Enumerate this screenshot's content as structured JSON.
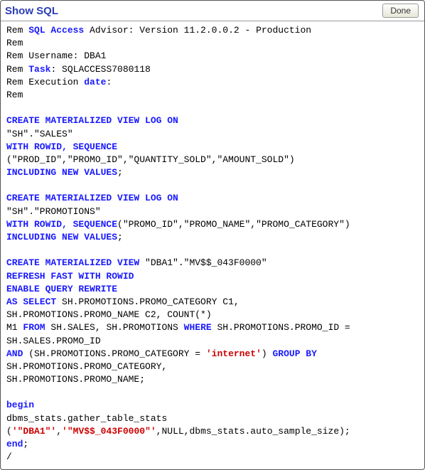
{
  "header": {
    "title": "Show SQL",
    "done_label": "Done"
  },
  "rem": {
    "l1_a": "Rem ",
    "l1_b": "SQL Access",
    "l1_c": " Advisor: Version 11.2.0.0.2 - Production",
    "l2": "Rem",
    "l3": "Rem Username: DBA1",
    "l4_a": "Rem ",
    "l4_b": "Task",
    "l4_c": ": SQLACCESS7080118",
    "l5_a": "Rem Execution ",
    "l5_b": "date",
    "l5_c": ":",
    "l6": "Rem"
  },
  "mvlog1": {
    "l1": "CREATE MATERIALIZED VIEW LOG ON",
    "l2": "\"SH\".\"SALES\"",
    "l3": "WITH ROWID, SEQUENCE",
    "l4": "(\"PROD_ID\",\"PROMO_ID\",\"QUANTITY_SOLD\",\"AMOUNT_SOLD\")",
    "l5_a": "INCLUDING NEW VALUES",
    "l5_b": ";"
  },
  "mvlog2": {
    "l1": "CREATE MATERIALIZED VIEW LOG ON",
    "l2": "\"SH\".\"PROMOTIONS\"",
    "l3_a": "WITH ROWID, SEQUENCE",
    "l3_b": "(\"PROMO_ID\",\"PROMO_NAME\",\"PROMO_CATEGORY\")",
    "l4_a": "INCLUDING NEW VALUES",
    "l4_b": ";"
  },
  "mv": {
    "l1_a": "CREATE MATERIALIZED VIEW",
    "l1_b": " \"DBA1\".\"MV$$_043F0000\"",
    "l2": "REFRESH FAST WITH ROWID",
    "l3": "ENABLE QUERY REWRITE",
    "l4_a": "AS SELECT",
    "l4_b": " SH.PROMOTIONS.PROMO_CATEGORY C1,",
    "l5": "SH.PROMOTIONS.PROMO_NAME C2, COUNT(*)",
    "l6_a": "M1 ",
    "l6_b": "FROM",
    "l6_c": " SH.SALES, SH.PROMOTIONS ",
    "l6_d": "WHERE",
    "l6_e": " SH.PROMOTIONS.PROMO_ID =",
    "l7": "SH.SALES.PROMO_ID",
    "l8_a": "AND",
    "l8_b": " (SH.PROMOTIONS.PROMO_CATEGORY = ",
    "l8_c": "'internet'",
    "l8_d": ") ",
    "l8_e": "GROUP BY",
    "l9": "SH.PROMOTIONS.PROMO_CATEGORY,",
    "l10": "SH.PROMOTIONS.PROMO_NAME;"
  },
  "plsql": {
    "l1": "begin",
    "l2": "dbms_stats.gather_table_stats",
    "l3_a": "(",
    "l3_b": "'\"DBA1\"'",
    "l3_c": ",",
    "l3_d": "'\"MV$$_043F0000\"'",
    "l3_e": ",NULL,dbms_stats.auto_sample_size);",
    "l4_a": "end",
    "l4_b": ";",
    "l5": "/"
  }
}
